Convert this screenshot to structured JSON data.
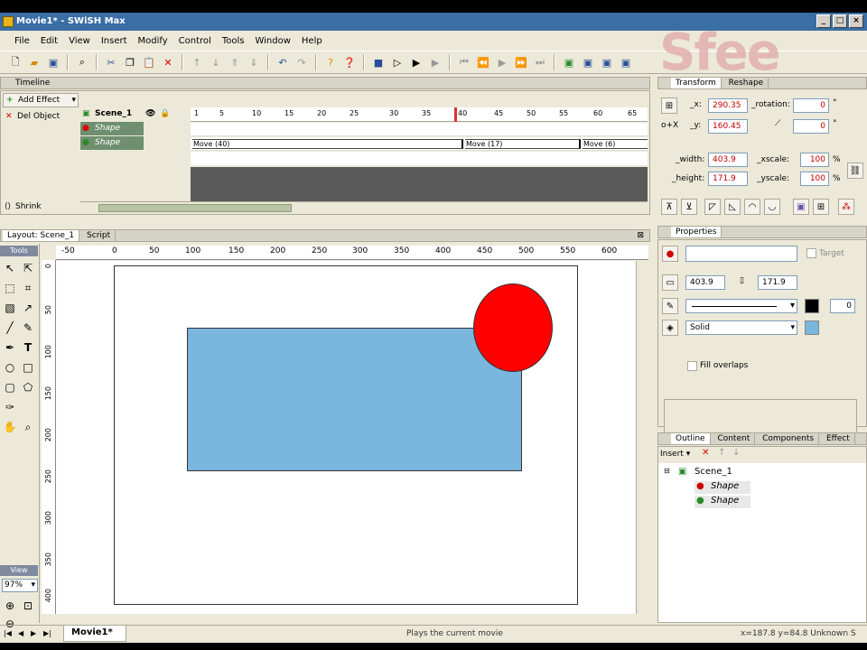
{
  "window": {
    "title": "Movie1* - SWiSH Max",
    "buttons": [
      "_",
      "□",
      "×"
    ]
  },
  "menu": [
    "File",
    "Edit",
    "View",
    "Insert",
    "Modify",
    "Control",
    "Tools",
    "Window",
    "Help"
  ],
  "watermark": "Sfee",
  "timeline": {
    "title": "Timeline",
    "add_effect": "Add Effect",
    "del_object": "Del Object",
    "shrink": "Shrink",
    "ruler": [
      "1",
      "5",
      "10",
      "15",
      "20",
      "25",
      "30",
      "35",
      "40",
      "45",
      "50",
      "55",
      "60",
      "65"
    ],
    "layers": [
      {
        "name": "Scene_1"
      },
      {
        "name": "Shape"
      },
      {
        "name": "Shape"
      }
    ],
    "effects": [
      "Move (40)",
      "Move (17)",
      "Move (6)"
    ]
  },
  "transform": {
    "tabs": [
      "Transform",
      "Reshape"
    ],
    "x_label": "_x:",
    "x_value": "290.35",
    "y_label": "_y:",
    "y_value": "160.45",
    "rotation_label": "_rotation:",
    "rotation_value": "0",
    "skew_value": "0",
    "width_label": "_width:",
    "width_value": "403.9",
    "height_label": "_height:",
    "height_value": "171.9",
    "xscale_label": "_xscale:",
    "xscale_value": "100",
    "yscale_label": "_yscale:",
    "yscale_value": "100",
    "deg": "°",
    "pct": "%"
  },
  "properties": {
    "title": "Properties",
    "target_label": "Target",
    "width_value": "403.9",
    "height_value": "171.9",
    "line_width": "0",
    "fill_type": "Solid",
    "fill_overlaps": "Fill overlaps"
  },
  "outline": {
    "tabs": [
      "Outline",
      "Content",
      "Components",
      "Effect"
    ],
    "insert": "Insert",
    "tree": [
      "Scene_1",
      "Shape",
      "Shape"
    ]
  },
  "layout": {
    "tabs": [
      "Layout: Scene_1",
      "Script"
    ],
    "tools_label": "Tools",
    "view_label": "View",
    "zoom": "97%",
    "hruler": [
      "-50",
      "0",
      "50",
      "100",
      "150",
      "200",
      "250",
      "300",
      "350",
      "400",
      "450",
      "500",
      "550",
      "600"
    ],
    "vruler": [
      "0",
      "50",
      "100",
      "150",
      "200",
      "250",
      "300",
      "350",
      "400"
    ]
  },
  "status": {
    "doc_tab": "Movie1*",
    "message": "Plays the current movie",
    "coords": "x=187.8 y=84.8 Unknown S"
  },
  "colors": {
    "rect_fill": "#7ab6de",
    "circle_fill": "#ff0000",
    "panel_bg": "#ece9d8",
    "dark_track": "#5a5a5a"
  }
}
